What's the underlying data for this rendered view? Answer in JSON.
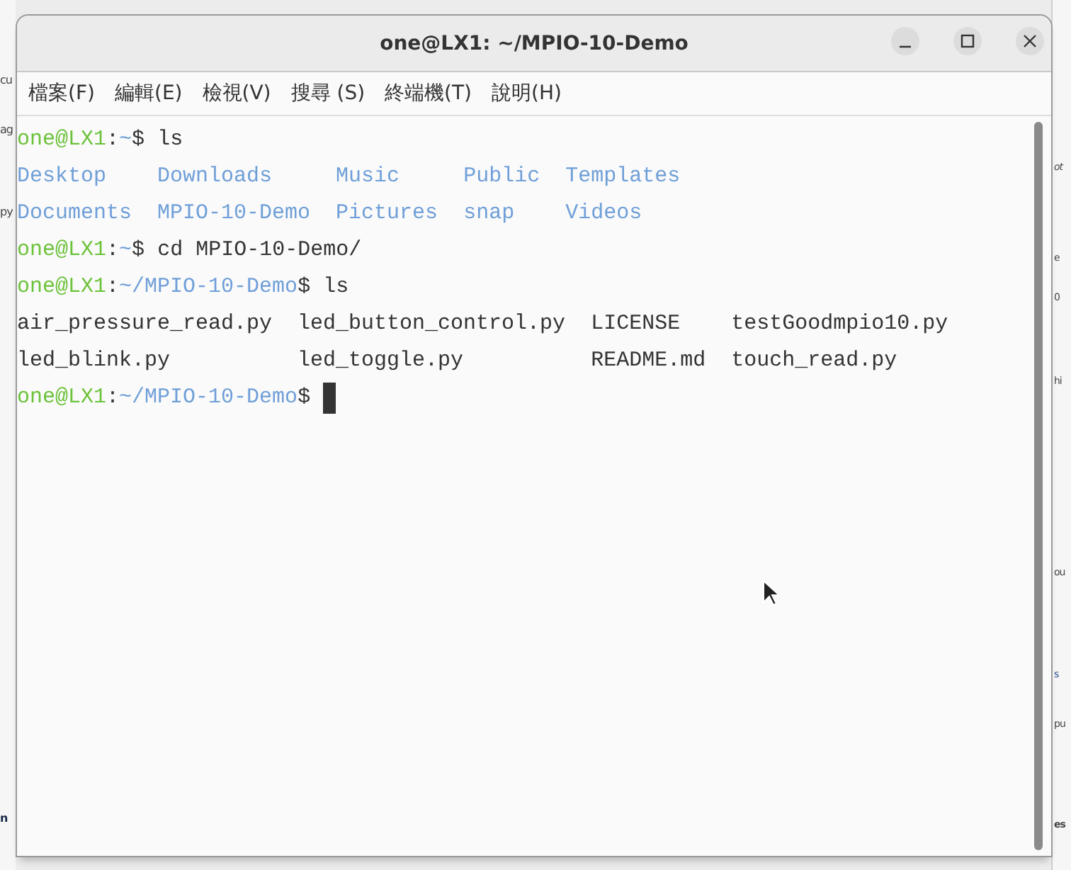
{
  "background_page": {
    "left_fragments": [
      "cu",
      "ag",
      "py",
      "n"
    ],
    "right_fragments": [
      "ot",
      "e",
      "0",
      "hi",
      "ou",
      "s",
      "pu",
      "es"
    ]
  },
  "window": {
    "title": "one@LX1: ~/MPIO-10-Demo"
  },
  "menu": [
    "檔案(F)",
    "編輯(E)",
    "檢視(V)",
    "搜尋 (S)",
    "終端機(T)",
    "說明(H)"
  ],
  "terminal": {
    "lines": [
      {
        "kind": "prompt",
        "user": "one@LX1",
        "separator": ":",
        "path": "~",
        "symbol": "$",
        "command": "ls"
      },
      {
        "kind": "listing",
        "rows": [
          [
            {
              "name": "Desktop",
              "dir": true
            },
            {
              "name": "Downloads",
              "dir": true
            },
            {
              "name": "Music",
              "dir": true
            },
            {
              "name": "Public",
              "dir": true
            },
            {
              "name": "Templates",
              "dir": true
            }
          ],
          [
            {
              "name": "Documents",
              "dir": true
            },
            {
              "name": "MPIO-10-Demo",
              "dir": true
            },
            {
              "name": "Pictures",
              "dir": true
            },
            {
              "name": "snap",
              "dir": true
            },
            {
              "name": "Videos",
              "dir": true
            }
          ]
        ]
      },
      {
        "kind": "prompt",
        "user": "one@LX1",
        "separator": ":",
        "path": "~",
        "symbol": "$",
        "command": "cd MPIO-10-Demo/"
      },
      {
        "kind": "prompt",
        "user": "one@LX1",
        "separator": ":",
        "path": "~/MPIO-10-Demo",
        "symbol": "$",
        "command": "ls"
      },
      {
        "kind": "listing",
        "rows": [
          [
            {
              "name": "air_pressure_read.py",
              "dir": false
            },
            {
              "name": "led_button_control.py",
              "dir": false
            },
            {
              "name": "LICENSE",
              "dir": false
            },
            {
              "name": "testGoodmpio10.py",
              "dir": false
            }
          ],
          [
            {
              "name": "led_blink.py",
              "dir": false
            },
            {
              "name": "led_toggle.py",
              "dir": false
            },
            {
              "name": "README.md",
              "dir": false
            },
            {
              "name": "touch_read.py",
              "dir": false
            }
          ]
        ]
      },
      {
        "kind": "prompt",
        "user": "one@LX1",
        "separator": ":",
        "path": "~/MPIO-10-Demo",
        "symbol": "$",
        "cursor": true
      }
    ]
  }
}
